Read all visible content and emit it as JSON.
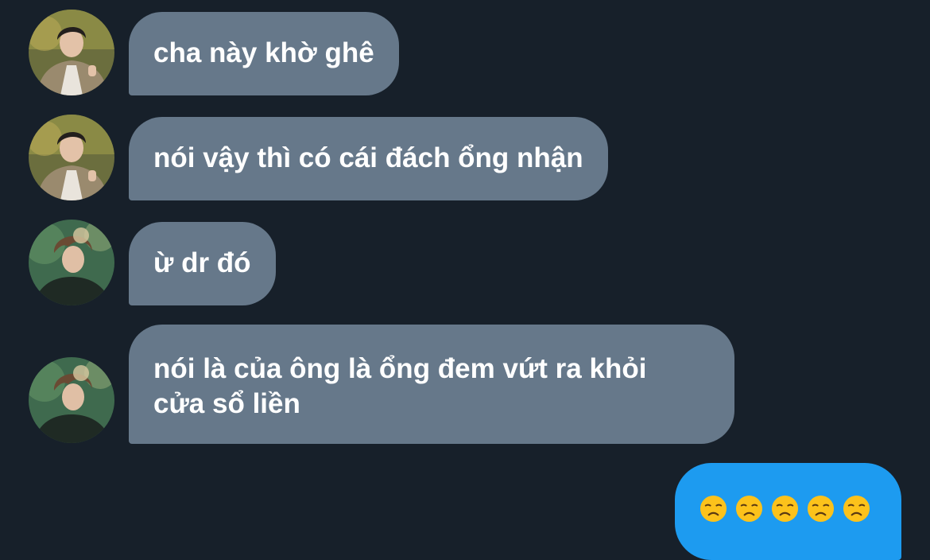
{
  "conversation": {
    "messages": [
      {
        "sender_avatar": "avatar-man-beige-jacket",
        "text": "cha này khờ ghê"
      },
      {
        "sender_avatar": "avatar-man-beige-jacket",
        "text": "nói vậy thì có cái đách ổng nhận"
      },
      {
        "sender_avatar": "avatar-man-forest-curly-hair",
        "text": "ừ dr đó"
      },
      {
        "sender_avatar": "avatar-man-forest-curly-hair",
        "text": "nói là của ông là ổng đem vứt ra khỏi cửa sổ liền"
      }
    ],
    "outgoing": {
      "emoji_name": "disappointed-face-icon",
      "emoji_count": 5
    }
  },
  "colors": {
    "background": "#17202a",
    "incoming_bubble": "#66788a",
    "outgoing_bubble": "#1d9bf0",
    "text": "#ffffff"
  }
}
